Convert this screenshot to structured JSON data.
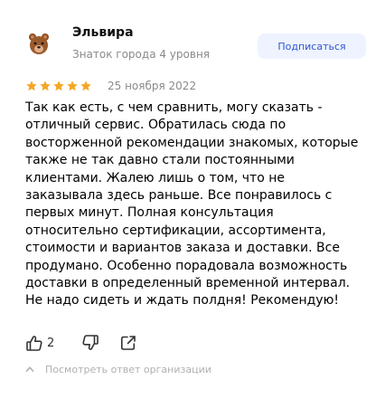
{
  "author": {
    "name": "Эльвира",
    "level": "Знаток города 4 уровня",
    "avatar_icon": "bear-face-icon"
  },
  "subscribe": {
    "label": "Подписаться"
  },
  "review": {
    "rating": 5,
    "rating_max": 5,
    "date": "25 ноября 2022",
    "text": "Так как есть, с чем сравнить, могу сказать - отличный сервис. Обратилась сюда по восторженной рекомендации знакомых, которые также не так давно стали постоянными клиентами. Жалею лишь о том, что не заказывала здесь раньше. Все понравилось с первых минут. Полная консультация относительно сертификации, ассортимента, стоимости и вариантов заказа и доставки. Все продумано. Особенно порадовала возможность доставки в определенный временной интервал. Не надо сидеть и ждать полдня! Рекомендую!"
  },
  "actions": {
    "like_count": "2",
    "like_icon": "thumbs-up-icon",
    "dislike_icon": "thumbs-down-icon",
    "share_icon": "share-icon"
  },
  "org_reply": {
    "label": "Посмотреть ответ организации",
    "icon": "chevron-up-icon"
  },
  "colors": {
    "star": "#f5a623",
    "accent": "#2f55d4",
    "button_bg": "#eef3ff",
    "muted": "#8a8a8a"
  }
}
